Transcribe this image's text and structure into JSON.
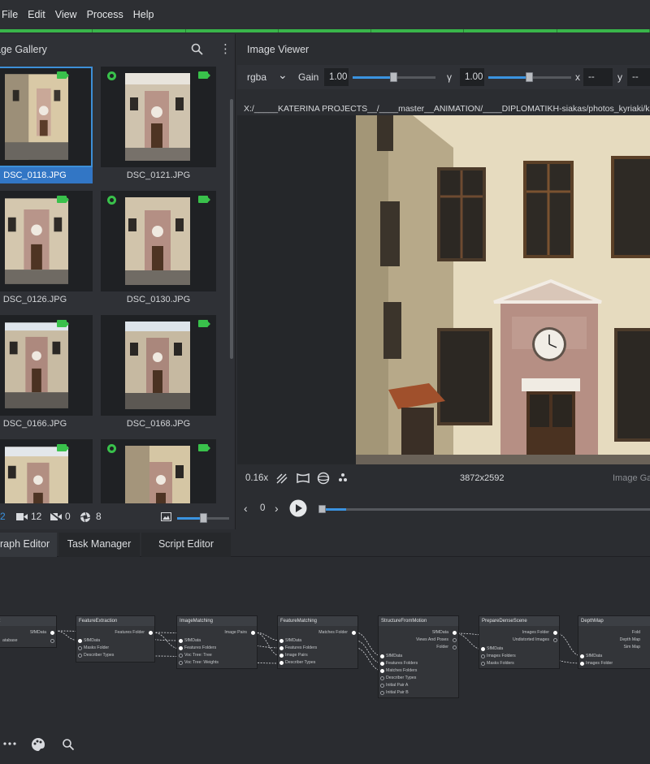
{
  "menu": [
    "File",
    "Edit",
    "View",
    "Process",
    "Help"
  ],
  "gallery": {
    "title": "age Gallery",
    "items": [
      {
        "name": "DSC_0118.JPG",
        "selected": true
      },
      {
        "name": "DSC_0121.JPG",
        "selected": false
      },
      {
        "name": "DSC_0126.JPG",
        "selected": false
      },
      {
        "name": "DSC_0130.JPG",
        "selected": false
      },
      {
        "name": "DSC_0166.JPG",
        "selected": false
      },
      {
        "name": "DSC_0168.JPG",
        "selected": false
      },
      {
        "name": "",
        "selected": false
      },
      {
        "name": "",
        "selected": false
      }
    ],
    "footer": {
      "count_partial": "2",
      "cameras": "12",
      "no_cameras": "0",
      "aperture": "8"
    }
  },
  "viewer": {
    "title": "Image Viewer",
    "channel": "rgba",
    "gain_label": "Gain",
    "gain_value": "1.00",
    "gamma_label": "γ",
    "gamma_value": "1.00",
    "x_label": "x",
    "x_value": "--",
    "y_label": "y",
    "y_value": "--",
    "path": "X:/_____KATERINA PROJECTS__/____master__ANIMATION/____DIPLOMATIKH-siakas/photos_kyriaki/koris en",
    "zoom": "0.16x",
    "resolution": "3872x2592",
    "bottom_right": "Image Ga",
    "frame": "0"
  },
  "lower_tabs": [
    "raph Editor",
    "Task Manager",
    "Script Editor"
  ],
  "graph": {
    "nodes": [
      {
        "title": "nit",
        "inputs": [],
        "outputs": [
          "SfMData",
          "atabase"
        ]
      },
      {
        "title": "FeatureExtraction",
        "inputs": [
          "SfMData",
          "Masks Folder",
          "Describer Types"
        ],
        "outputs": [
          "Features Folder"
        ]
      },
      {
        "title": "ImageMatching",
        "inputs": [
          "SfMData",
          "Features Folders",
          "Voc Tree: Tree",
          "Voc Tree: Weights"
        ],
        "outputs": [
          "Image Pairs"
        ]
      },
      {
        "title": "FeatureMatching",
        "inputs": [
          "SfMData",
          "Features Folders",
          "Image Pairs",
          "Describer Types"
        ],
        "outputs": [
          "Matches Folder"
        ]
      },
      {
        "title": "StructureFromMotion",
        "inputs": [
          "SfMData",
          "Features Folders",
          "Matches Folders",
          "Describer Types",
          "Initial Pair A",
          "Initial Pair B"
        ],
        "outputs": [
          "SfMData",
          "Views And Poses",
          "Folder"
        ]
      },
      {
        "title": "PrepareDenseScene",
        "inputs": [
          "SfMData",
          "Images Folders",
          "Masks Folders"
        ],
        "outputs": [
          "Images Folder",
          "Undistorted Images"
        ]
      },
      {
        "title": "DepthMap",
        "inputs": [
          "SfMData",
          "Images Folder"
        ],
        "outputs": [
          "Fold",
          "Depth Map",
          "Sim Map"
        ]
      }
    ]
  },
  "colors": {
    "accent": "#3a93e0",
    "status_green": "#39c14b",
    "selection": "#3276c5"
  }
}
